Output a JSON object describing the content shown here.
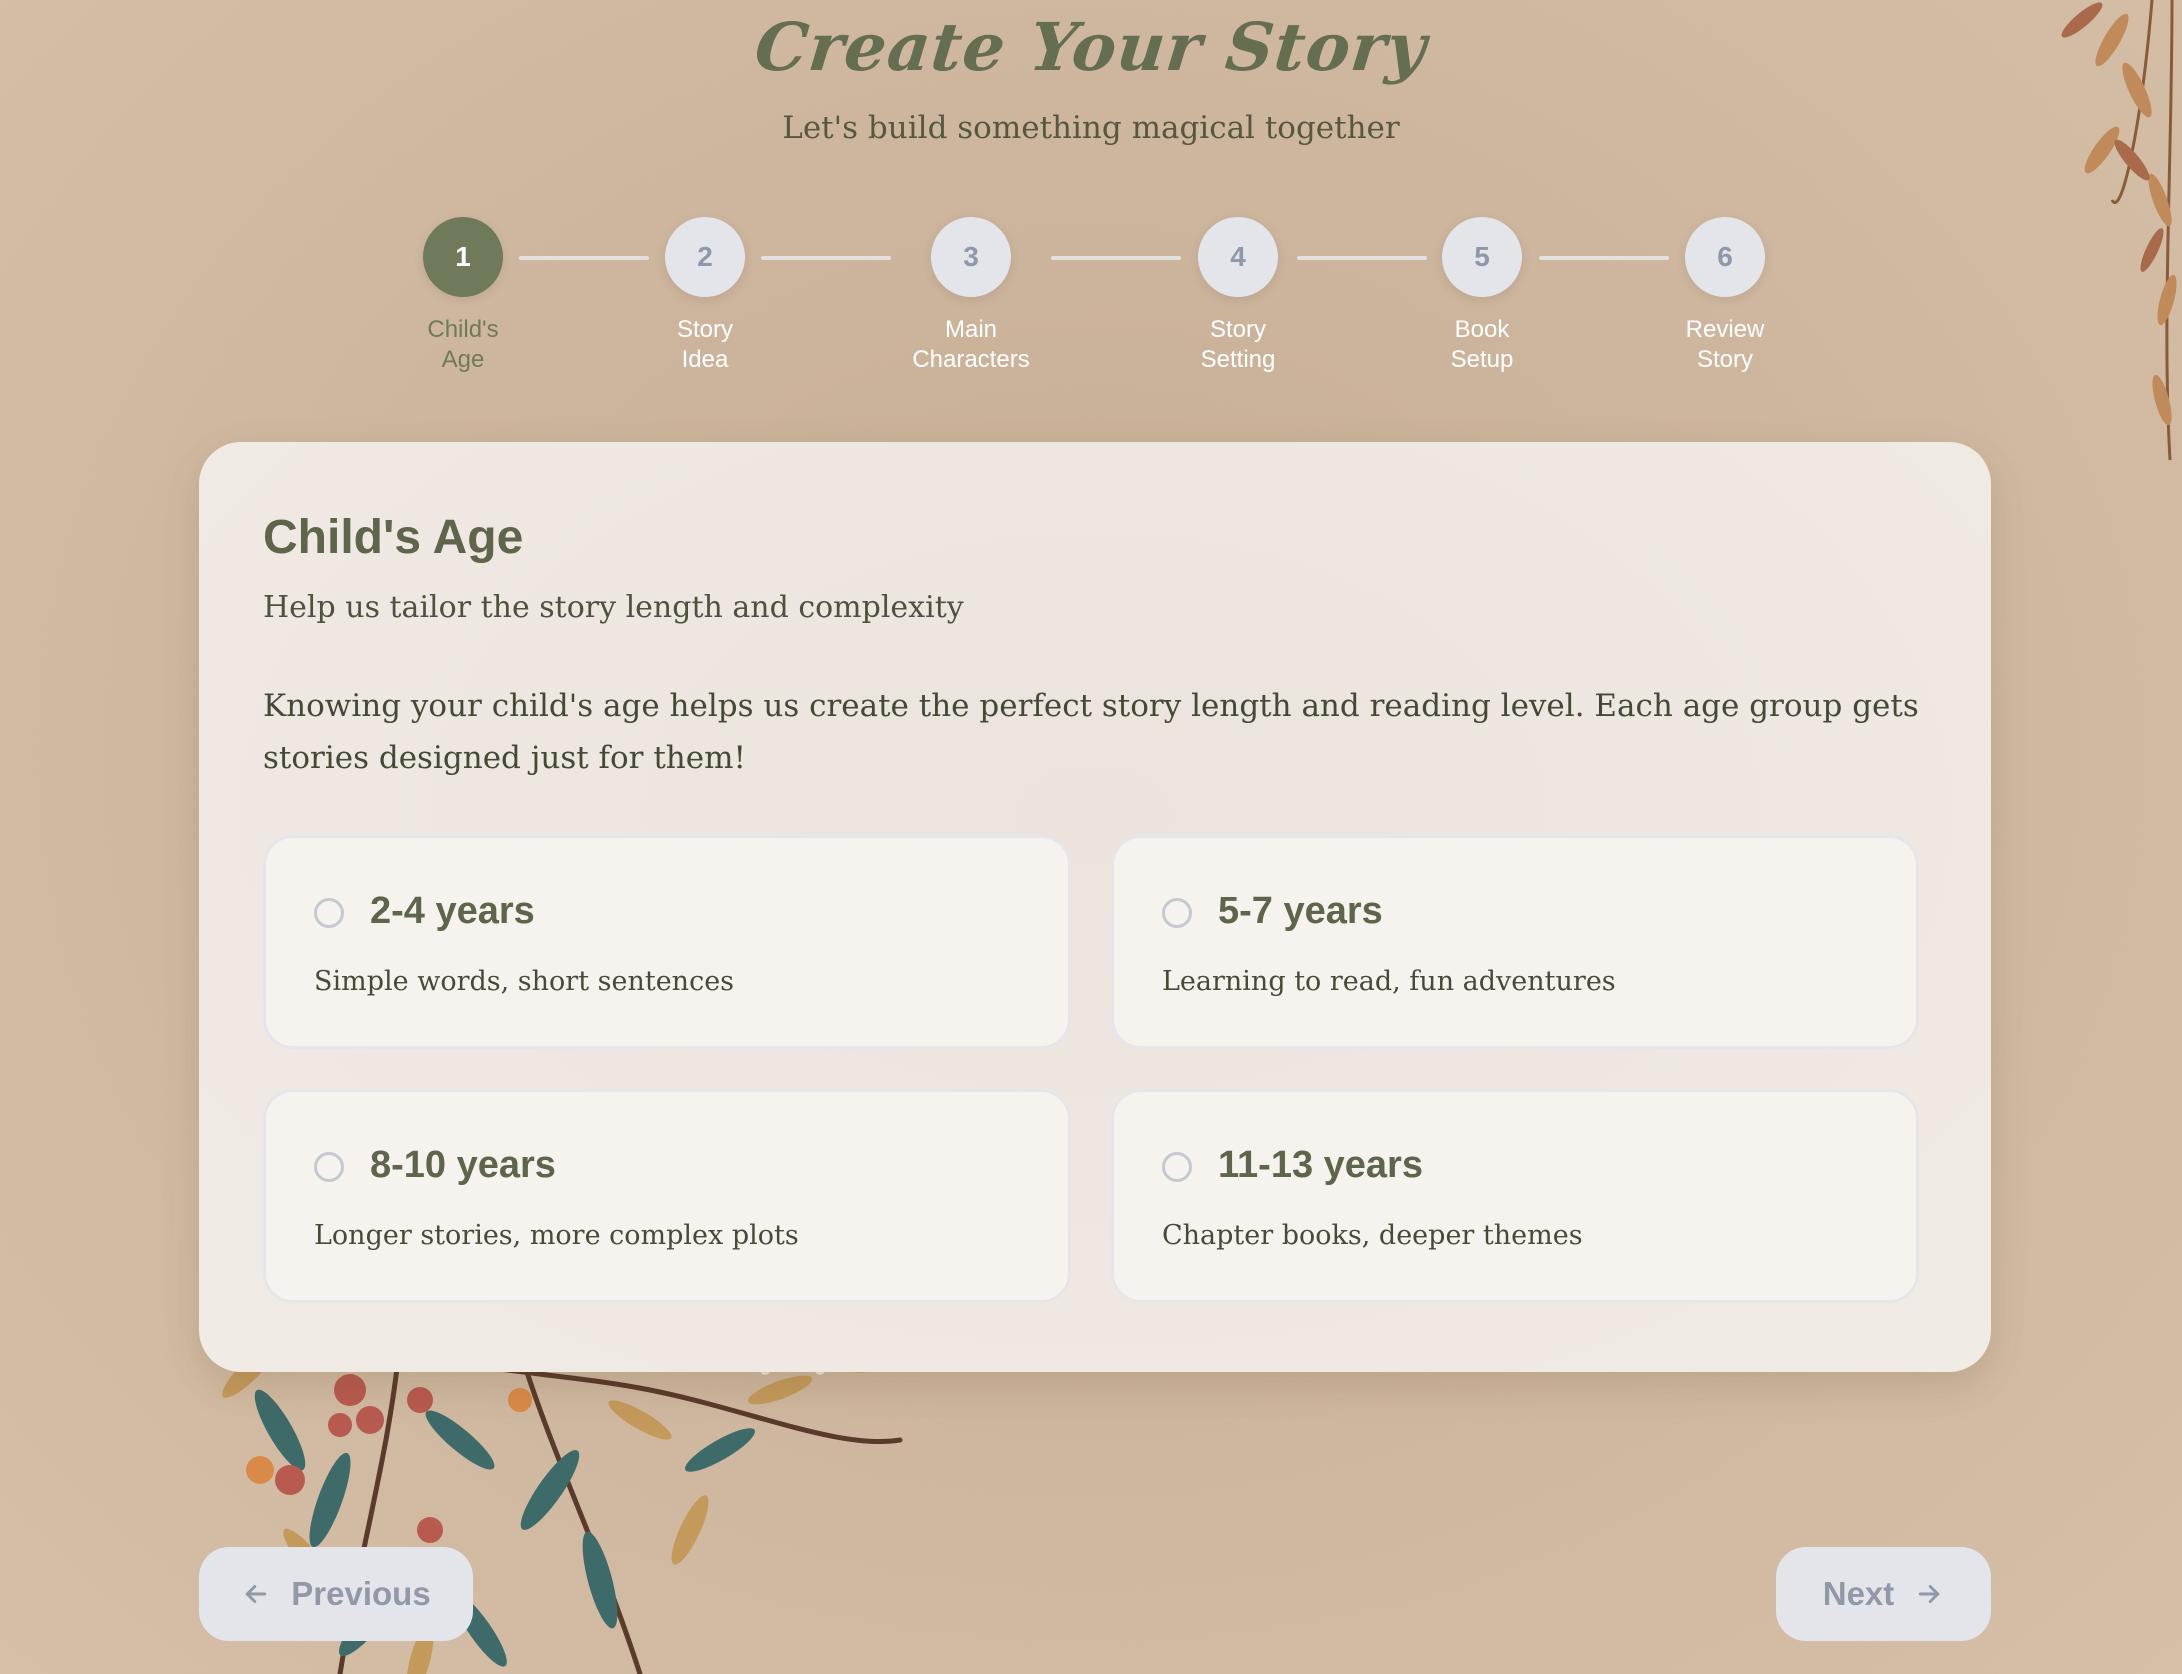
{
  "header": {
    "title": "Create Your Story",
    "subtitle": "Let's build something magical together"
  },
  "stepper": {
    "active_step": 1,
    "steps": [
      {
        "number": "1",
        "label_line1": "Child's",
        "label_line2": "Age"
      },
      {
        "number": "2",
        "label_line1": "Story",
        "label_line2": "Idea"
      },
      {
        "number": "3",
        "label_line1": "Main",
        "label_line2": "Characters"
      },
      {
        "number": "4",
        "label_line1": "Story",
        "label_line2": "Setting"
      },
      {
        "number": "5",
        "label_line1": "Book",
        "label_line2": "Setup"
      },
      {
        "number": "6",
        "label_line1": "Review",
        "label_line2": "Story"
      }
    ]
  },
  "card": {
    "title": "Child's Age",
    "subtitle": "Help us tailor the story length and complexity",
    "description": "Knowing your child's age helps us create the perfect story length and reading level. Each age group gets stories designed just for them!",
    "options": [
      {
        "label": "2-4 years",
        "description": "Simple words, short sentences",
        "selected": false
      },
      {
        "label": "5-7 years",
        "description": "Learning to read, fun adventures",
        "selected": false
      },
      {
        "label": "8-10 years",
        "description": "Longer stories, more complex plots",
        "selected": false
      },
      {
        "label": "11-13 years",
        "description": "Chapter books, deeper themes",
        "selected": false
      }
    ]
  },
  "navigation": {
    "previous_label": "Previous",
    "next_label": "Next"
  },
  "colors": {
    "accent": "#6f7a5a",
    "heading": "#5e654a",
    "inactive_step": "#e3e5eb",
    "button_text": "#9198a8"
  }
}
